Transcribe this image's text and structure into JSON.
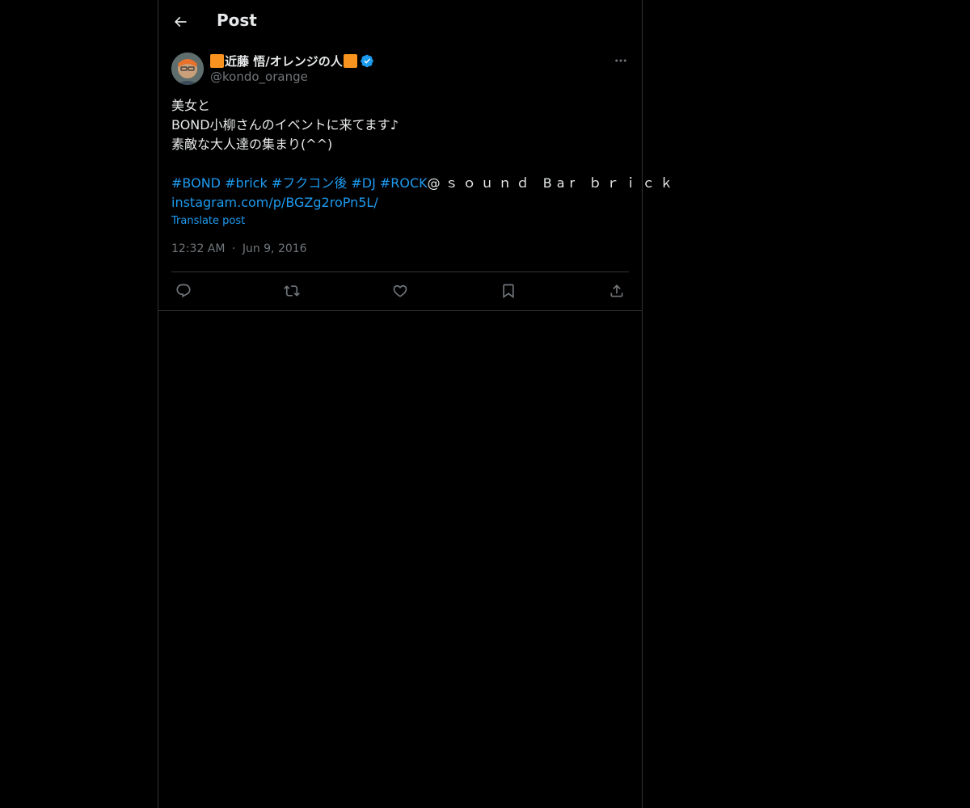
{
  "header": {
    "title": "Post",
    "back_icon": "arrow-left-icon"
  },
  "author": {
    "display_name": "近藤 悟/オレンジの人",
    "handle": "@kondo_orange",
    "badge_color": "#f7931e",
    "verified_color": "#1d9bf0"
  },
  "tweet": {
    "text": "美女と\nBOND小柳さんのイベントに来てます♪\n素敵な大人達の集まり(^^)",
    "hashtags": [
      "#BOND",
      "#brick",
      "#フクコン後",
      "#DJ",
      "#ROCK"
    ],
    "venue": "@ｓｏｕｎｄ Bar ｂｒｉｃｋ",
    "link": "instagram.com/p/BGZg2roPn5L/",
    "translate_label": "Translate post"
  },
  "meta": {
    "time": "12:32 AM",
    "separator": "·",
    "date": "Jun 9, 2016"
  },
  "actions": [
    "reply-icon",
    "repost-icon",
    "like-icon",
    "bookmark-icon",
    "share-icon"
  ],
  "colors": {
    "accent": "#1d9bf0",
    "text": "#e7e9ea",
    "muted": "#71767b",
    "border": "#2f3336",
    "background": "#000000"
  }
}
